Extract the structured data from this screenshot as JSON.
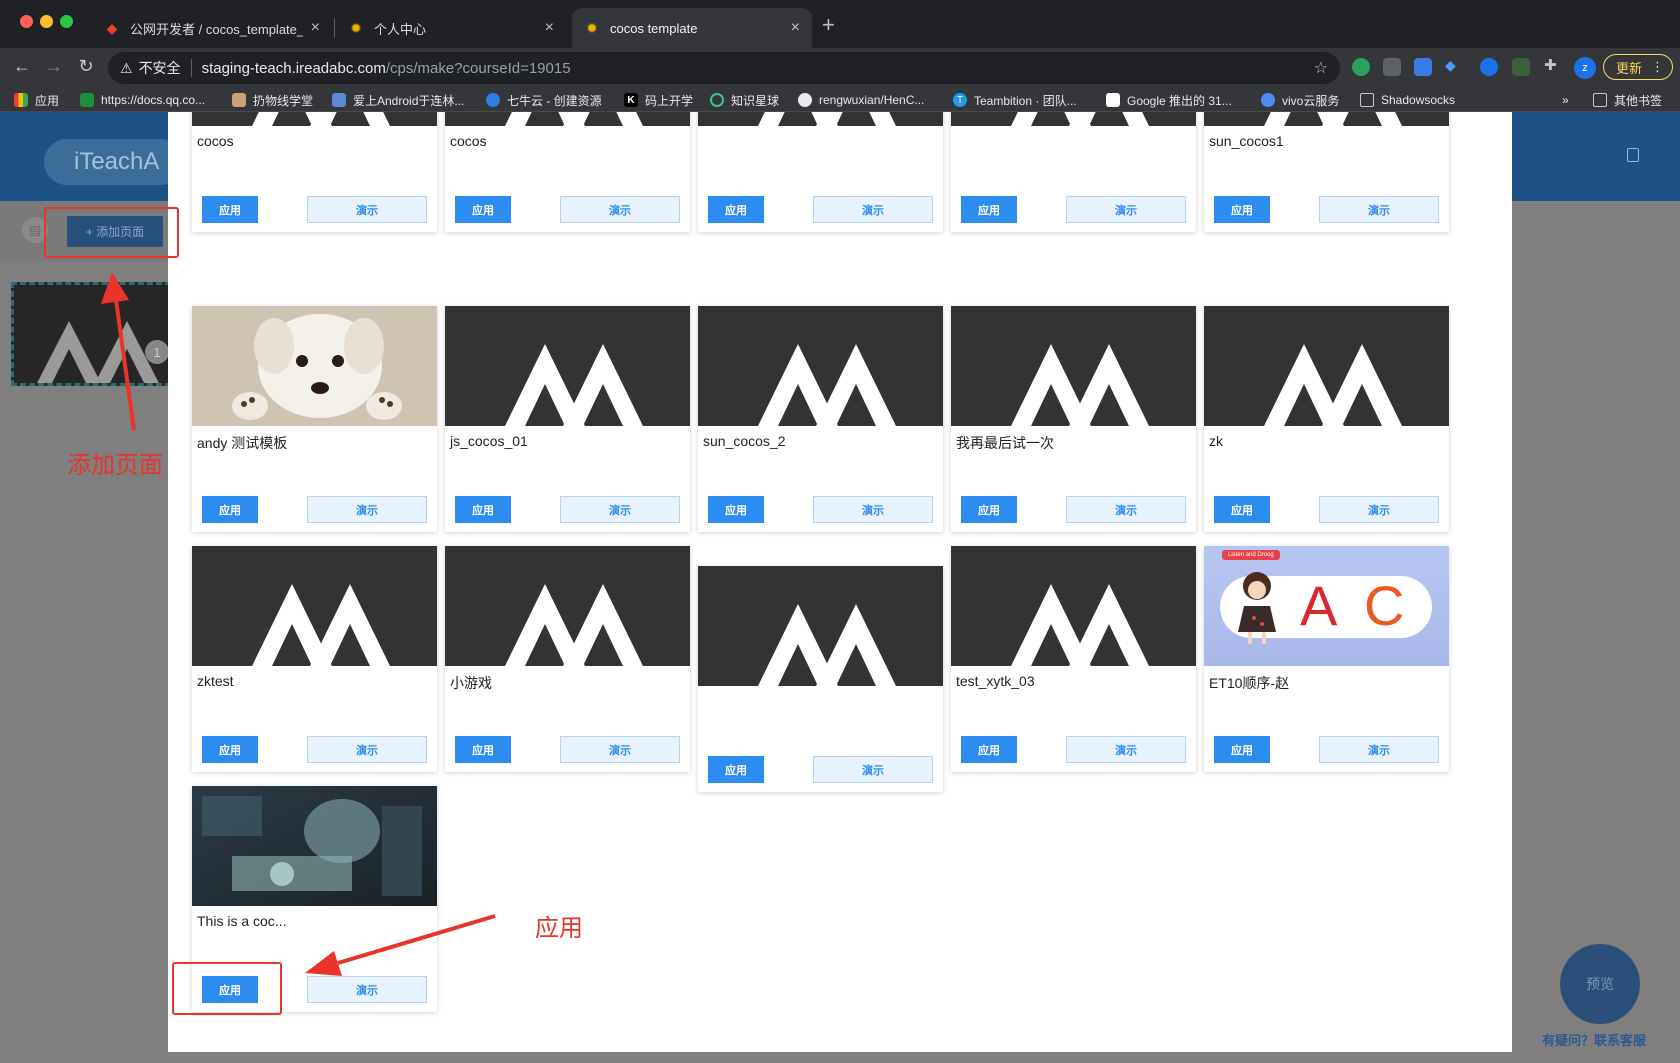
{
  "browser": {
    "tabs": [
      {
        "title": "公网开发者 / cocos_template_...",
        "icon": "gitlab-icon"
      },
      {
        "title": "个人中心",
        "icon": "sun-icon"
      },
      {
        "title": "cocos template",
        "icon": "sun-icon",
        "active": true
      }
    ],
    "address": {
      "security_label": "不安全",
      "host": "staging-teach.ireadabc.com",
      "path": "/cps/make?courseId=19015"
    },
    "profile_initial": "z",
    "update_label": "更新",
    "bookmarks": [
      {
        "label": "应用",
        "icon": "apps-grid-icon"
      },
      {
        "label": "https://docs.qq.co...",
        "icon": "docs-icon"
      },
      {
        "label": "扔物线学堂",
        "icon": "avatar-icon"
      },
      {
        "label": "爱上Android于连林...",
        "icon": "blog-icon"
      },
      {
        "label": "七牛云 - 创建资源",
        "icon": "qiniu-icon"
      },
      {
        "label": "码上开学",
        "icon": "k-icon"
      },
      {
        "label": "知识星球",
        "icon": "planet-icon"
      },
      {
        "label": "rengwuxian/HenC...",
        "icon": "github-icon"
      },
      {
        "label": "Teambition · 团队...",
        "icon": "teambition-icon"
      },
      {
        "label": "Google 推出的 31...",
        "icon": "google-icon"
      },
      {
        "label": "vivo云服务",
        "icon": "vivo-icon"
      },
      {
        "label": "Shadowsocks",
        "icon": "folder-icon"
      }
    ],
    "overflow_label": "»",
    "other_bookmarks": "其他书签"
  },
  "page": {
    "logo_text": "iTeachA",
    "add_page_label": "+ 添加页面",
    "slide_number": "1",
    "preview_label": "预览",
    "help_label": "有疑问？联系客服"
  },
  "modal": {
    "apply_label": "应用",
    "demo_label": "演示",
    "templates": [
      {
        "name": "cocos",
        "thumb": "cocos-logo"
      },
      {
        "name": "cocos",
        "thumb": "cocos-logo"
      },
      {
        "name": "",
        "thumb": "cocos-logo"
      },
      {
        "name": "",
        "thumb": "cocos-logo"
      },
      {
        "name": "sun_cocos1",
        "thumb": "cocos-logo"
      },
      {
        "name": "andy 测试模板",
        "thumb": "puppy-photo"
      },
      {
        "name": "js_cocos_01",
        "thumb": "cocos-logo"
      },
      {
        "name": "sun_cocos_2",
        "thumb": "cocos-logo"
      },
      {
        "name": "我再最后试一次",
        "thumb": "cocos-logo"
      },
      {
        "name": "zk",
        "thumb": "cocos-logo"
      },
      {
        "name": "zktest",
        "thumb": "cocos-logo"
      },
      {
        "name": "小游戏",
        "thumb": "cocos-logo"
      },
      {
        "name": "",
        "thumb": "cocos-logo"
      },
      {
        "name": "test_xytk_03",
        "thumb": "cocos-logo"
      },
      {
        "name": "ET10顺序-赵",
        "thumb": "abc-cartoon"
      },
      {
        "name": "This is a coc...",
        "thumb": "scifi-art"
      }
    ],
    "abc_banner_text": "Listen and Droog",
    "abc_letters": [
      "A",
      "C"
    ]
  },
  "annotations": {
    "add_page_note": "添加页面",
    "apply_note": "应用",
    "color": "#e8342a"
  }
}
